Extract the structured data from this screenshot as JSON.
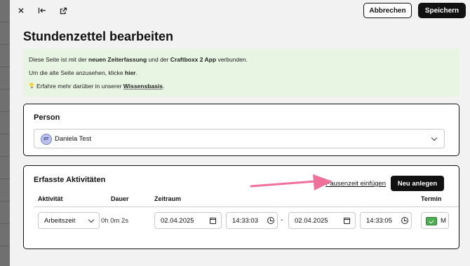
{
  "header": {
    "close_icon": "close-icon",
    "collapse_icon": "arrow-left-bar-icon",
    "open_external_icon": "external-link-icon",
    "cancel_label": "Abbrechen",
    "save_label": "Speichern"
  },
  "page": {
    "title": "Stundenzettel bearbeiten"
  },
  "notice": {
    "line1_prefix": "Diese Seite ist mit der ",
    "line1_bold1": "neuen Zeiterfassung",
    "line1_mid": " und der ",
    "line1_bold2": "Craftboxx 2 App",
    "line1_suffix": " verbunden.",
    "line2_prefix": "Um die alte Seite anzusehen, klicke ",
    "line2_link": "hier",
    "line2_suffix": ".",
    "line3_prefix": "Erfahre mehr darüber in unserer ",
    "line3_link": "Wissensbasis",
    "line3_suffix": "."
  },
  "person": {
    "section_title": "Person",
    "avatar_initials": "DT",
    "selected_name": "Daniela Test"
  },
  "activities": {
    "section_title": "Erfasste Aktivitäten",
    "pause_link": "Pausenzeit einfügen",
    "new_button": "Neu anlegen",
    "columns": [
      "Aktivität",
      "Dauer",
      "Zeitraum",
      "Termin"
    ],
    "rows": [
      {
        "activity": "Arbeitszeit",
        "duration": "0h 0m 2s",
        "start_date": "02.04.2025",
        "start_time": "14:33:03",
        "separator": "-",
        "end_date": "02.04.2025",
        "end_time": "14:33:05",
        "termin_partial": "M"
      }
    ]
  },
  "annotation": {
    "arrow_color": "#f0709a"
  },
  "colors": {
    "notice_bg": "#e8f5e3",
    "primary": "#111111",
    "check_green": "#4caf50"
  }
}
